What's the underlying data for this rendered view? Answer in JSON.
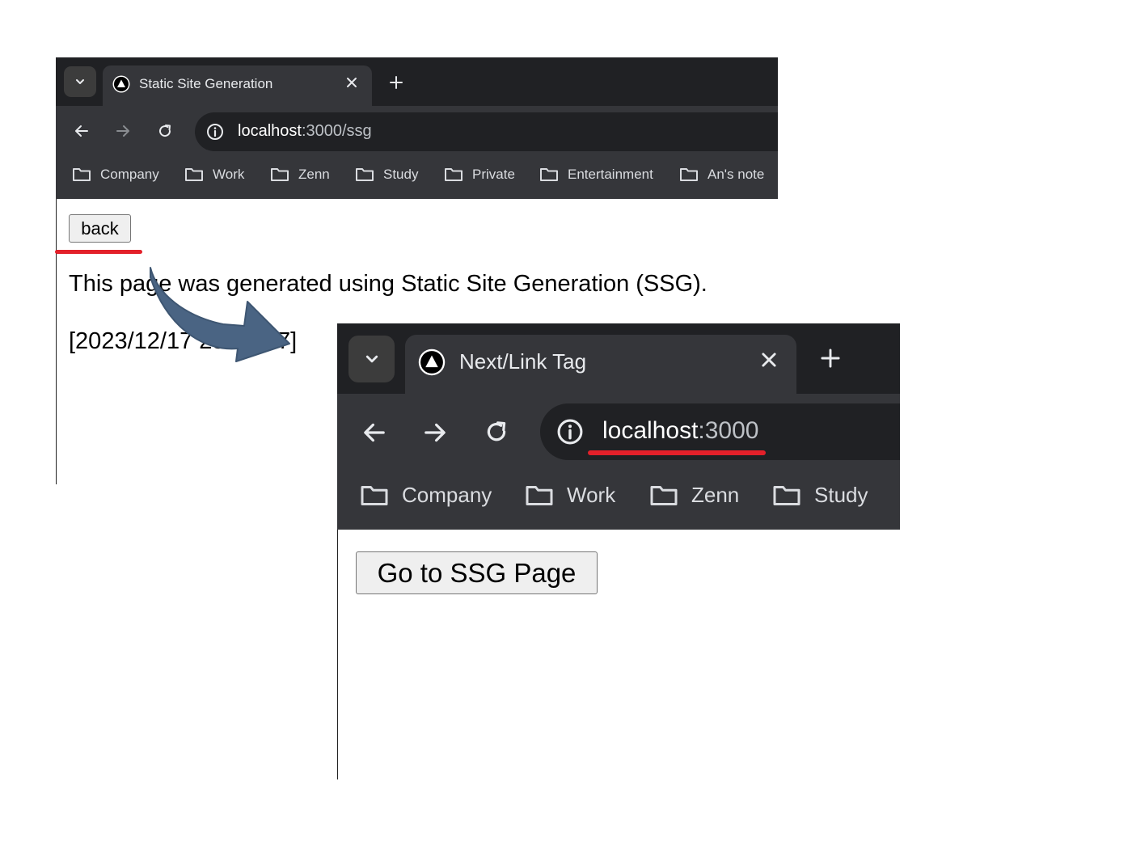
{
  "windowA": {
    "tab": {
      "title": "Static Site Generation"
    },
    "url": {
      "host": "localhost",
      "path": ":3000/ssg"
    },
    "bookmarks": [
      "Company",
      "Work",
      "Zenn",
      "Study",
      "Private",
      "Entertainment",
      "An's note"
    ],
    "page": {
      "back_label": "back",
      "line1": "This page was generated using Static Site Generation (SSG).",
      "timestamp": "[2023/12/17 23:00:37]"
    }
  },
  "windowB": {
    "tab": {
      "title": "Next/Link Tag"
    },
    "url": {
      "host": "localhost",
      "path": ":3000"
    },
    "bookmarks": [
      "Company",
      "Work",
      "Zenn",
      "Study"
    ],
    "page": {
      "button_label": "Go to SSG Page"
    }
  },
  "colors": {
    "highlight": "#e3202a",
    "arrow": "#4a6483"
  }
}
